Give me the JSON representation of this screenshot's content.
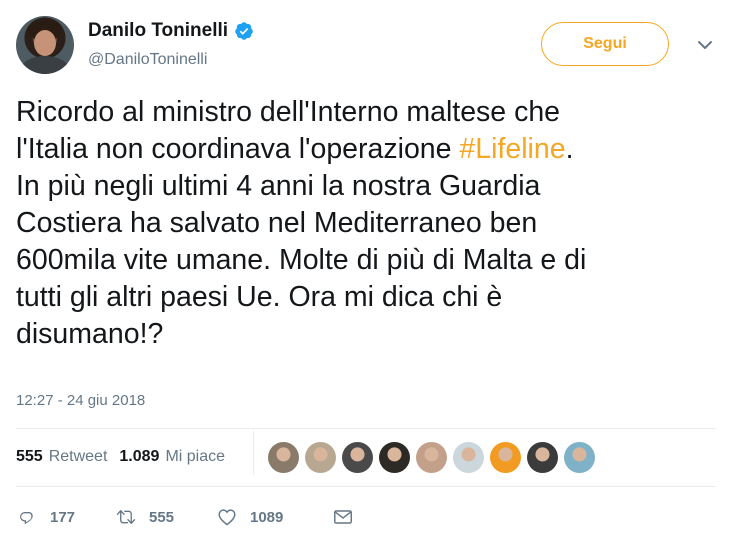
{
  "author": {
    "display_name": "Danilo Toninelli",
    "handle": "@DaniloToninelli",
    "verified": true
  },
  "follow_button": {
    "label": "Segui"
  },
  "tweet": {
    "lines": [
      {
        "text": "Ricordo al ministro dell'Interno maltese che"
      },
      {
        "before": "l'Italia non coordinava l'operazione ",
        "hashtag": "#Lifeline",
        "after": "."
      },
      {
        "text": "In più negli ultimi 4 anni la nostra Guardia"
      },
      {
        "text": "Costiera ha salvato nel Mediterraneo ben"
      },
      {
        "text": "600mila vite umane. Molte di più di Malta e di"
      },
      {
        "text": "tutti gli altri paesi Ue. Ora mi dica chi è"
      },
      {
        "text": "disumano!?"
      }
    ],
    "timestamp": "12:27 - 24 giu 2018"
  },
  "stats": {
    "retweets": {
      "count": "555",
      "label": "Retweet"
    },
    "likes": {
      "count": "1.089",
      "label": "Mi piace"
    }
  },
  "likers": [
    {
      "bg": "#8a7a6a"
    },
    {
      "bg": "#b8a892"
    },
    {
      "bg": "#4a4a4a"
    },
    {
      "bg": "#2d2a26"
    },
    {
      "bg": "#c2a08a"
    },
    {
      "bg": "#ccd6dd"
    },
    {
      "bg": "#f29b22"
    },
    {
      "bg": "#3b3b3b"
    },
    {
      "bg": "#7fb2c8"
    }
  ],
  "actions": {
    "reply": {
      "count": "177",
      "icon": "reply-icon"
    },
    "retweet": {
      "count": "555",
      "icon": "retweet-icon"
    },
    "like": {
      "count": "1089",
      "icon": "heart-icon"
    },
    "dm": {
      "icon": "envelope-icon"
    }
  },
  "colors": {
    "accent": "#f5a623",
    "verified": "#1da1f2",
    "muted": "#657786",
    "text": "#14171a"
  }
}
